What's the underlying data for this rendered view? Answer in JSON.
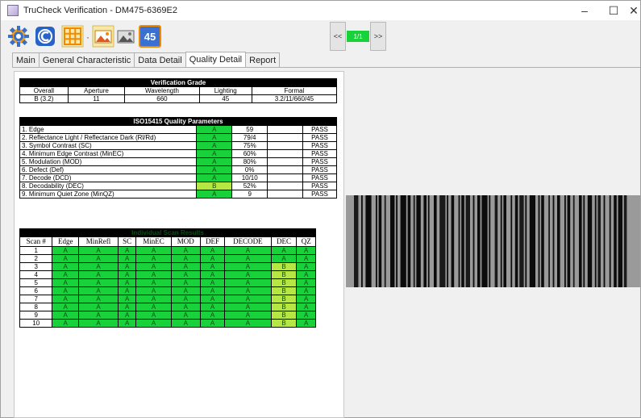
{
  "window": {
    "title": "TruCheck Verification - DM475-6369E2",
    "minimize": "–",
    "maximize": "☐",
    "close": "✕"
  },
  "toolbar": {
    "icons": [
      "gear-icon",
      "c-icon",
      "grid-icon",
      "image-icon",
      "image-gray-icon",
      "number-45-icon"
    ],
    "number_label": "45",
    "separator": "·",
    "nav_prev": "<<",
    "nav_page": "1/1",
    "nav_next": ">>"
  },
  "tabs": [
    "Main",
    "General Characteristic",
    "Data Detail",
    "Quality Detail",
    "Report"
  ],
  "active_tab": "Quality Detail",
  "colors": {
    "grade_a": "#19d13a",
    "grade_b": "#b6e644",
    "header_bg": "#000000"
  },
  "verification_grade": {
    "title": "Verification Grade",
    "headers": [
      "Overall",
      "Aperture",
      "Wavelength",
      "Lighting",
      "Formal"
    ],
    "values": [
      "B (3.2)",
      "11",
      "660",
      "45",
      "3.2/11/660/45"
    ]
  },
  "iso_parameters": {
    "title": "ISO15415 Quality Parameters",
    "rows": [
      {
        "name": "1. Edge",
        "grade": "A",
        "value": "59",
        "result": "PASS"
      },
      {
        "name": "2. Reflectance Light / Reflectance Dark (Rl/Rd)",
        "grade": "A",
        "value": "79/4",
        "result": "PASS"
      },
      {
        "name": "3. Symbol Contrast (SC)",
        "grade": "A",
        "value": "75%",
        "result": "PASS"
      },
      {
        "name": "4. Minimum Edge Contrast (MinEC)",
        "grade": "A",
        "value": "60%",
        "result": "PASS"
      },
      {
        "name": "5. Modulation (MOD)",
        "grade": "A",
        "value": "80%",
        "result": "PASS"
      },
      {
        "name": "6. Defect (Def)",
        "grade": "A",
        "value": "0%",
        "result": "PASS"
      },
      {
        "name": "7. Decode (DCD)",
        "grade": "A",
        "value": "10/10",
        "result": "PASS"
      },
      {
        "name": "8. Decodability (DEC)",
        "grade": "B",
        "value": "52%",
        "result": "PASS"
      },
      {
        "name": "9. Minimum Quiet Zone (MinQZ)",
        "grade": "A",
        "value": "9",
        "result": "PASS"
      }
    ]
  },
  "scan_results": {
    "title": "Individual Scan Results",
    "headers": [
      "Scan #",
      "Edge",
      "MinRefl",
      "SC",
      "MinEC",
      "MOD",
      "DEF",
      "DECODE",
      "DEC",
      "QZ"
    ],
    "rows": [
      [
        "1",
        "A",
        "A",
        "A",
        "A",
        "A",
        "A",
        "A",
        "A",
        "A"
      ],
      [
        "2",
        "A",
        "A",
        "A",
        "A",
        "A",
        "A",
        "A",
        "A",
        "A"
      ],
      [
        "3",
        "A",
        "A",
        "A",
        "A",
        "A",
        "A",
        "A",
        "B",
        "A"
      ],
      [
        "4",
        "A",
        "A",
        "A",
        "A",
        "A",
        "A",
        "A",
        "B",
        "A"
      ],
      [
        "5",
        "A",
        "A",
        "A",
        "A",
        "A",
        "A",
        "A",
        "B",
        "A"
      ],
      [
        "6",
        "A",
        "A",
        "A",
        "A",
        "A",
        "A",
        "A",
        "B",
        "A"
      ],
      [
        "7",
        "A",
        "A",
        "A",
        "A",
        "A",
        "A",
        "A",
        "B",
        "A"
      ],
      [
        "8",
        "A",
        "A",
        "A",
        "A",
        "A",
        "A",
        "A",
        "B",
        "A"
      ],
      [
        "9",
        "A",
        "A",
        "A",
        "A",
        "A",
        "A",
        "A",
        "B",
        "A"
      ],
      [
        "10",
        "A",
        "A",
        "A",
        "A",
        "A",
        "A",
        "A",
        "B",
        "A"
      ]
    ]
  }
}
